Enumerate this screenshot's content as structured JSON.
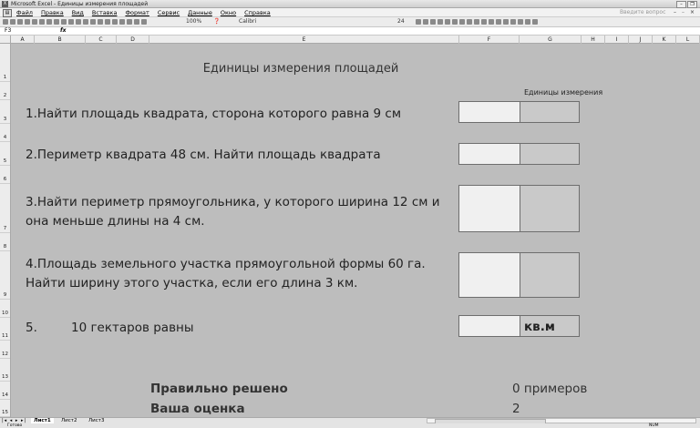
{
  "window": {
    "title": "Microsoft Excel - Единицы измерения площадей",
    "app_icon": "excel-icon"
  },
  "menu": {
    "items": [
      "Файл",
      "Правка",
      "Вид",
      "Вставка",
      "Формат",
      "Сервис",
      "Данные",
      "Окно",
      "Справка"
    ],
    "help_placeholder": "Введите вопрос"
  },
  "toolbar": {
    "zoom": "100%",
    "font": "Calibri",
    "font_size": "24"
  },
  "formula_bar": {
    "name_box": "F3",
    "fx": "fx"
  },
  "columns": [
    "A",
    "B",
    "C",
    "D",
    "E",
    "F",
    "G",
    "H",
    "I",
    "J",
    "K",
    "L"
  ],
  "rows": [
    "1",
    "2",
    "3",
    "4",
    "5",
    "6",
    "7",
    "8",
    "9",
    "10",
    "11",
    "12",
    "13",
    "14",
    "15"
  ],
  "sheet": {
    "title": "Единицы измерения площадей",
    "units_header": "Единицы измерения",
    "q1": "1.Найти площадь квадрата, сторона которого равна 9 см",
    "q2": "2.Периметр квадрата 48 см. Найти площадь квадрата",
    "q3_line1": "3.Найти периметр прямоугольника, у которого ширина 12 см и",
    "q3_line2": "она меньше длины на 4 см.",
    "q4_line1": "4.Площадь земельного участка прямоугольной формы 60 га.",
    "q4_line2": "Найти ширину этого участка, если его длина 3 км.",
    "q5_num": "5.",
    "q5_text": "10 гектаров равны",
    "q5_unit": "кв.м",
    "correct_label": "Правильно решено",
    "correct_value": "0 примеров",
    "grade_label": "Ваша оценка",
    "grade_value": "2"
  },
  "tabs": [
    "Лист1",
    "Лист2",
    "Лист3"
  ],
  "status": {
    "ready": "Готово",
    "mode": "NUM"
  }
}
